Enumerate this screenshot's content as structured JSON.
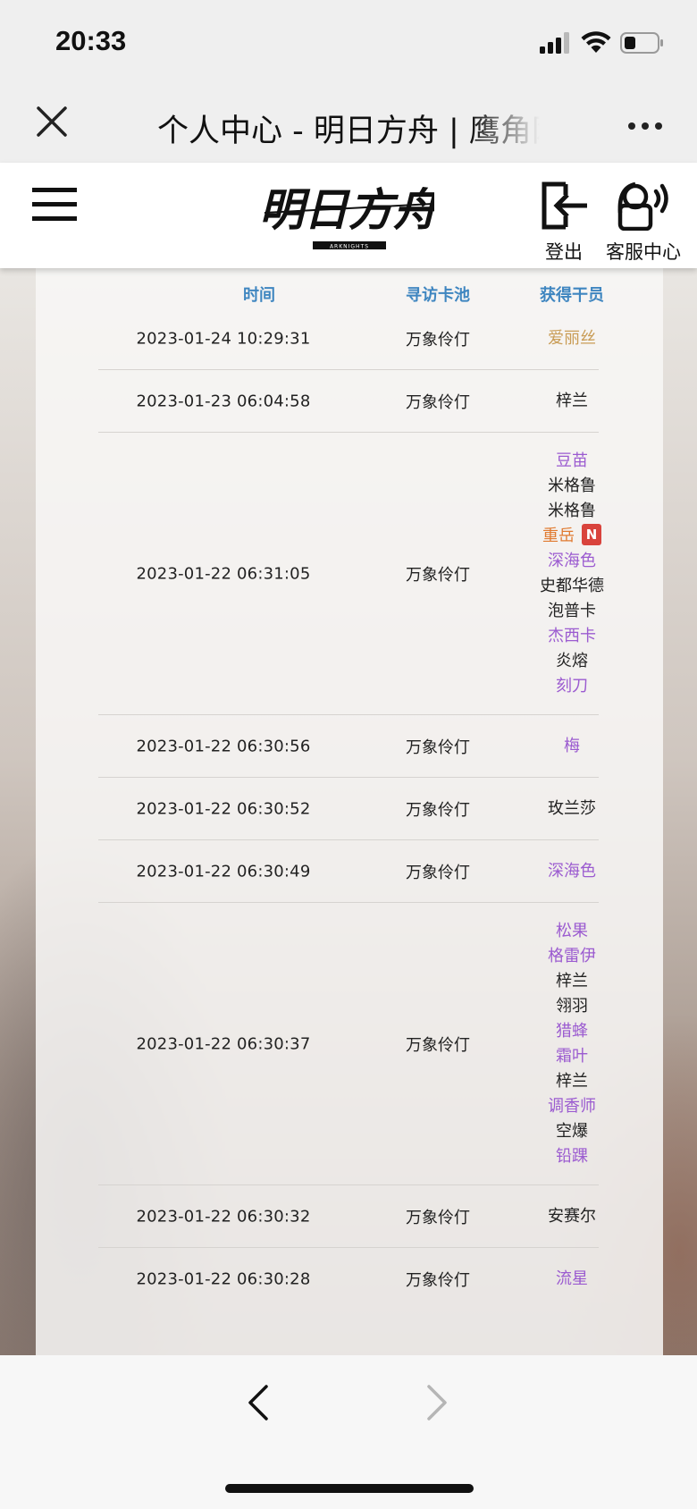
{
  "status": {
    "time": "20:33"
  },
  "browser": {
    "title": "个人中心 - 明日方舟 | 鹰角网络"
  },
  "site": {
    "logo_text": "明日方舟",
    "logo_sub": "ARKNIGHTS",
    "logout_label": "登出",
    "service_label": "客服中心"
  },
  "table": {
    "headers": {
      "time": "时间",
      "pool": "寻访卡池",
      "operator": "获得干员"
    },
    "rows": [
      {
        "time": "2023-01-24 10:29:31",
        "pool": "万象伶仃",
        "operators": [
          {
            "name": "爱丽丝",
            "rarity": 5,
            "color": "#c99c55"
          }
        ]
      },
      {
        "time": "2023-01-23 06:04:58",
        "pool": "万象伶仃",
        "operators": [
          {
            "name": "梓兰",
            "rarity": 3,
            "color": "#222222"
          }
        ]
      },
      {
        "time": "2023-01-22 06:31:05",
        "pool": "万象伶仃",
        "operators": [
          {
            "name": "豆苗",
            "rarity": 4,
            "color": "#9b5bd0"
          },
          {
            "name": "米格鲁",
            "rarity": 3,
            "color": "#222222"
          },
          {
            "name": "米格鲁",
            "rarity": 3,
            "color": "#222222"
          },
          {
            "name": "重岳",
            "rarity": 6,
            "color": "#e07a30",
            "badge": "N"
          },
          {
            "name": "深海色",
            "rarity": 4,
            "color": "#9b5bd0"
          },
          {
            "name": "史都华德",
            "rarity": 3,
            "color": "#222222"
          },
          {
            "name": "泡普卡",
            "rarity": 3,
            "color": "#222222"
          },
          {
            "name": "杰西卡",
            "rarity": 4,
            "color": "#9b5bd0"
          },
          {
            "name": "炎熔",
            "rarity": 3,
            "color": "#222222"
          },
          {
            "name": "刻刀",
            "rarity": 4,
            "color": "#9b5bd0"
          }
        ]
      },
      {
        "time": "2023-01-22 06:30:56",
        "pool": "万象伶仃",
        "operators": [
          {
            "name": "梅",
            "rarity": 4,
            "color": "#9b5bd0"
          }
        ]
      },
      {
        "time": "2023-01-22 06:30:52",
        "pool": "万象伶仃",
        "operators": [
          {
            "name": "玫兰莎",
            "rarity": 3,
            "color": "#222222"
          }
        ]
      },
      {
        "time": "2023-01-22 06:30:49",
        "pool": "万象伶仃",
        "operators": [
          {
            "name": "深海色",
            "rarity": 4,
            "color": "#9b5bd0"
          }
        ]
      },
      {
        "time": "2023-01-22 06:30:37",
        "pool": "万象伶仃",
        "operators": [
          {
            "name": "松果",
            "rarity": 4,
            "color": "#9b5bd0"
          },
          {
            "name": "格雷伊",
            "rarity": 4,
            "color": "#9b5bd0"
          },
          {
            "name": "梓兰",
            "rarity": 3,
            "color": "#222222"
          },
          {
            "name": "翎羽",
            "rarity": 3,
            "color": "#222222"
          },
          {
            "name": "猎蜂",
            "rarity": 4,
            "color": "#9b5bd0"
          },
          {
            "name": "霜叶",
            "rarity": 4,
            "color": "#9b5bd0"
          },
          {
            "name": "梓兰",
            "rarity": 3,
            "color": "#222222"
          },
          {
            "name": "调香师",
            "rarity": 4,
            "color": "#9b5bd0"
          },
          {
            "name": "空爆",
            "rarity": 3,
            "color": "#222222"
          },
          {
            "name": "铅踝",
            "rarity": 4,
            "color": "#9b5bd0"
          }
        ]
      },
      {
        "time": "2023-01-22 06:30:32",
        "pool": "万象伶仃",
        "operators": [
          {
            "name": "安赛尔",
            "rarity": 3,
            "color": "#222222"
          }
        ]
      },
      {
        "time": "2023-01-22 06:30:28",
        "pool": "万象伶仃",
        "operators": [
          {
            "name": "流星",
            "rarity": 4,
            "color": "#9b5bd0"
          }
        ]
      }
    ]
  }
}
